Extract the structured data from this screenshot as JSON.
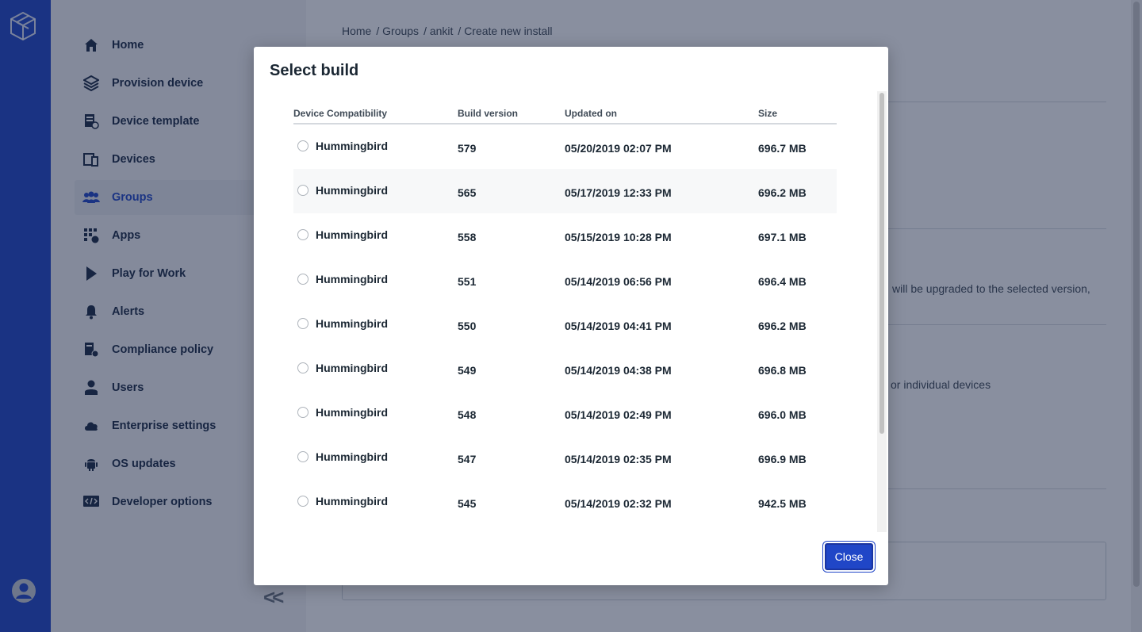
{
  "sidebar": {
    "items": [
      {
        "label": "Home",
        "icon": "home-icon"
      },
      {
        "label": "Provision device",
        "icon": "provision-icon"
      },
      {
        "label": "Device template",
        "icon": "template-icon"
      },
      {
        "label": "Devices",
        "icon": "devices-icon"
      },
      {
        "label": "Groups",
        "icon": "groups-icon",
        "active": true
      },
      {
        "label": "Apps",
        "icon": "apps-icon"
      },
      {
        "label": "Play for Work",
        "icon": "play-icon"
      },
      {
        "label": "Alerts",
        "icon": "bell-icon"
      },
      {
        "label": "Compliance policy",
        "icon": "compliance-icon"
      },
      {
        "label": "Users",
        "icon": "user-icon"
      },
      {
        "label": "Enterprise settings",
        "icon": "cloud-icon"
      },
      {
        "label": "OS updates",
        "icon": "android-icon"
      },
      {
        "label": "Developer options",
        "icon": "code-icon"
      }
    ],
    "collapse_label": "<<"
  },
  "breadcrumb": [
    "Home",
    "/ Groups",
    "/ ankit",
    "/ Create new install"
  ],
  "background": {
    "text_upgrade": "will be upgraded to the selected version,",
    "text_devices": "or individual devices"
  },
  "modal": {
    "title": "Select build",
    "columns": [
      "Device Compatibility",
      "Build version",
      "Updated on",
      "Size"
    ],
    "rows": [
      {
        "device": "Hummingbird",
        "build": "579",
        "updated": "05/20/2019 02:07 PM",
        "size": "696.7 MB"
      },
      {
        "device": "Hummingbird",
        "build": "565",
        "updated": "05/17/2019 12:33 PM",
        "size": "696.2 MB"
      },
      {
        "device": "Hummingbird",
        "build": "558",
        "updated": "05/15/2019 10:28 PM",
        "size": "697.1 MB"
      },
      {
        "device": "Hummingbird",
        "build": "551",
        "updated": "05/14/2019 06:56 PM",
        "size": "696.4 MB"
      },
      {
        "device": "Hummingbird",
        "build": "550",
        "updated": "05/14/2019 04:41 PM",
        "size": "696.2 MB"
      },
      {
        "device": "Hummingbird",
        "build": "549",
        "updated": "05/14/2019 04:38 PM",
        "size": "696.8 MB"
      },
      {
        "device": "Hummingbird",
        "build": "548",
        "updated": "05/14/2019 02:49 PM",
        "size": "696.0 MB"
      },
      {
        "device": "Hummingbird",
        "build": "547",
        "updated": "05/14/2019 02:35 PM",
        "size": "696.9 MB"
      },
      {
        "device": "Hummingbird",
        "build": "545",
        "updated": "05/14/2019 02:32 PM",
        "size": "942.5 MB"
      }
    ],
    "close_label": "Close"
  },
  "colors": {
    "brand": "#2046c7",
    "overlay": "#142040"
  }
}
